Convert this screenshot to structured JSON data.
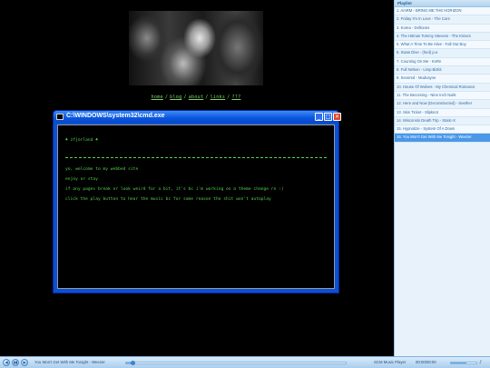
{
  "nav": {
    "links": [
      "home",
      "blog",
      "about",
      "links",
      "???"
    ],
    "separator": "/"
  },
  "window": {
    "title": "C:\\WINDOWS\\system32\\cmd.exe",
    "buttons": {
      "minimize": "_",
      "maximize": "□",
      "close": "✕"
    }
  },
  "console": {
    "heading": "zfjorland",
    "clover": "♣",
    "lines": [
      "yo, welcome to my webbed site",
      "enjoy or stay",
      "if any pages break or look weird for a bit, it's bc i'm working on a theme change rn :)",
      "click the play button to hear the music bc for some reason the shit won't autoplay"
    ]
  },
  "playlist": {
    "title": "Playlist",
    "items": [
      "1. AmRM - BRING ME THE HORIZON",
      "2. Friday I'm In Love - The Cure",
      "3. Korea - Deftones",
      "4. The Hitman Tommy Stevens - The Knives",
      "5. What A Time To Be Alive - Fall Out Boy",
      "6. Swan Dive - (hed) p.e.",
      "7. Counting On Me - KoRn",
      "8. Full Nelson - Limp Bizkit",
      "9. Severed - Mudvayne",
      "10. House Of Wolves - My Chemical Romance",
      "11. The Becoming - Nine Inch Nails",
      "12. Here and Now (Deconstructed) - Seether",
      "13. Skin Ticket - Slipknot",
      "14. Wisconsin Death Trip - Static-X",
      "15. Hypnotize - System Of A Down",
      "16. You Won't Get With Me Tonight - Weezer"
    ],
    "active_index": 15
  },
  "player": {
    "controls": [
      "◀",
      "▮▮",
      "▶"
    ],
    "now_playing": "You Won't Get With Me Tonight - Weezer",
    "progress": 0.03,
    "app_name": "SCM Music Player",
    "time": "00:00/00:00",
    "volume": 0.6,
    "volume_icon": "♪"
  },
  "colors": {
    "console_text": "#56d24a",
    "nav_link": "#7fd36b",
    "playlist_active": "#4a97e8",
    "titlebar": "#0a56e0"
  }
}
